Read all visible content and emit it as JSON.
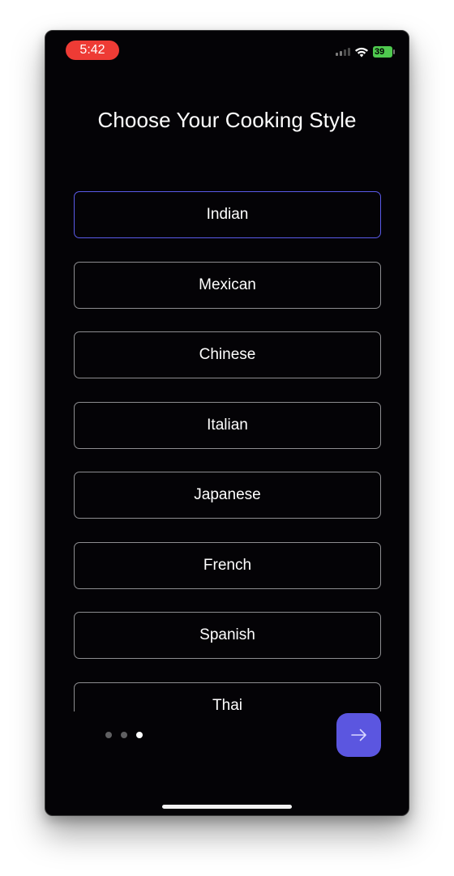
{
  "status_bar": {
    "time": "5:42",
    "battery": "39"
  },
  "page_title": "Choose Your Cooking Style",
  "options": [
    {
      "label": "Indian",
      "selected": true
    },
    {
      "label": "Mexican",
      "selected": false
    },
    {
      "label": "Chinese",
      "selected": false
    },
    {
      "label": "Italian",
      "selected": false
    },
    {
      "label": "Japanese",
      "selected": false
    },
    {
      "label": "French",
      "selected": false
    },
    {
      "label": "Spanish",
      "selected": false
    },
    {
      "label": "Thai",
      "selected": false
    }
  ],
  "pagination": {
    "total": 3,
    "current": 3
  },
  "colors": {
    "background": "#040306",
    "accent": "#5b56e0",
    "selected_border": "#5a5ae8",
    "time_pill": "#ee3b35",
    "battery": "#4fc94f"
  },
  "icons": {
    "next": "arrow-right-icon",
    "wifi": "wifi-icon",
    "signal": "cellular-signal-icon",
    "battery": "battery-icon"
  }
}
